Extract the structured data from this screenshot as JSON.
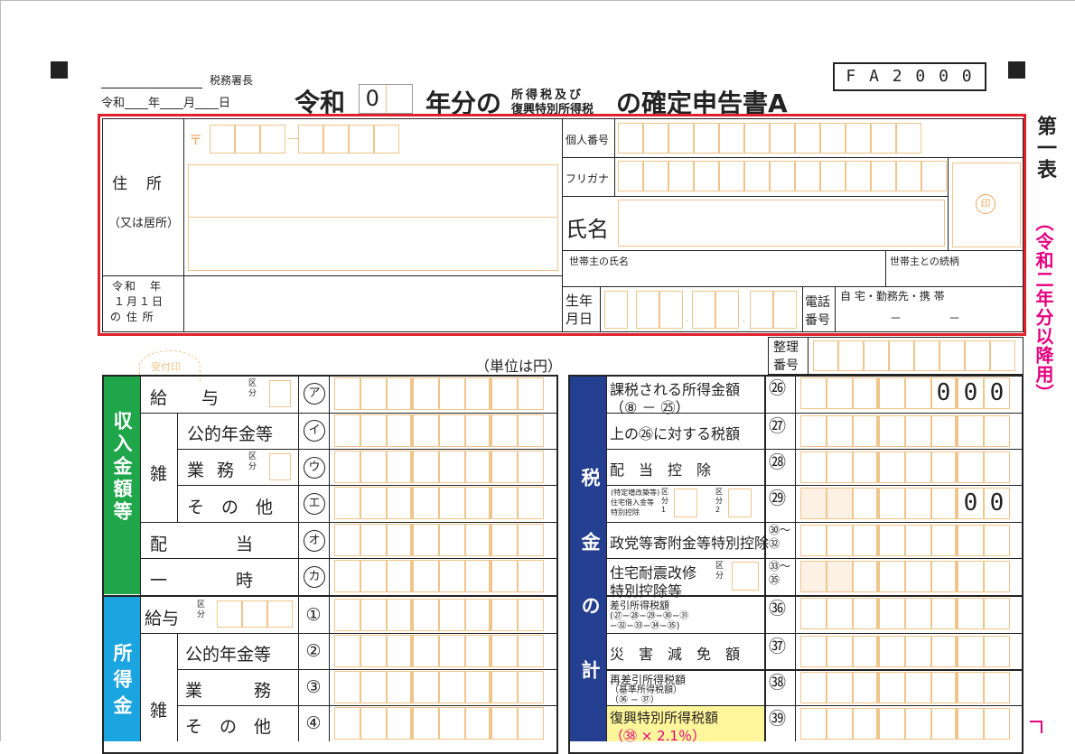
{
  "colors": {
    "red": "#e0222c",
    "orange": "#f0c48a",
    "green": "#1fa64b",
    "cyan": "#1ba5e0",
    "navy": "#243f8f",
    "magenta": "#e6007e",
    "yellow": "#fff59a"
  },
  "header": {
    "office": "税務署長",
    "date_line": "令和____年____月____日",
    "era": "令和",
    "year_box": "0",
    "year_suffix": "年分の",
    "tax_top": "所得税及び",
    "tax_bottom": "復興特別所得税",
    "title": "の確定申告書A",
    "form_code": "F A 2 0 0 0",
    "side": "第一表",
    "side_paren": "（令和二年分以降用）"
  },
  "address": {
    "postal": "〒",
    "label": "住　所",
    "label_sub": "（又は居所）",
    "jan_line1": "令和　年",
    "jan_line2": "１月１日",
    "jan_line3": "の 住 所"
  },
  "identity": {
    "my_number": "個人番号",
    "furigana": "フリガナ",
    "name": "氏名",
    "seal": "印",
    "householder": "世帯主の氏名",
    "relation": "世帯主との続柄",
    "birth1": "生年",
    "birth2": "月日",
    "phone1": "電話",
    "phone2": "番号",
    "phone_types": "自 宅・勤務先・携 帯",
    "phone_dash": "－　　　　－"
  },
  "office_use": {
    "reception": "受付印",
    "seiri1": "整理",
    "seiri2": "番号"
  },
  "unit": "（単位は円）",
  "income": {
    "section": "収入金額等",
    "rows": [
      {
        "label": "給　　与",
        "mark": "ア",
        "kubun": "区分"
      },
      {
        "label": "公的年金等",
        "mark": "イ"
      },
      {
        "label": "業 務",
        "mark": "ウ",
        "kubun": "区分"
      },
      {
        "label": "そ　の　他",
        "mark": "エ"
      },
      {
        "label": "配　　　　当",
        "mark": "オ"
      },
      {
        "label": "一　　　　時",
        "mark": "カ"
      }
    ],
    "zatsu": "雑"
  },
  "shotoku": {
    "section": "所得金",
    "rows": [
      {
        "label": "給与",
        "mark": "①",
        "kubun": "区分"
      },
      {
        "label": "公的年金等",
        "mark": "②"
      },
      {
        "label": "業　　　務",
        "mark": "③"
      },
      {
        "label": "そ　の　他",
        "mark": "④"
      }
    ],
    "zatsu": "雑"
  },
  "tax": {
    "section": "税金の計",
    "rows": [
      {
        "label1": "課税される所得金額",
        "label2": "（⑧ － ㉕）",
        "mark": "㉖",
        "fixed": "000"
      },
      {
        "label1": "上の㉖に対する税額",
        "mark": "㉗"
      },
      {
        "label1": "配　当　控　除",
        "mark": "㉘"
      },
      {
        "label1": "(特定増改築等)",
        "label2": "住宅借入金等",
        "label3": "特別控除",
        "k1": "区分1",
        "k2": "区分2",
        "mark": "㉙",
        "fixed": "00"
      },
      {
        "label1": "政党等寄附金等特別控除",
        "mark": "㉚〜㉜"
      },
      {
        "label1": "住宅耐震改修",
        "label2": "特別控除等",
        "k1": "区分",
        "mark": "㉝〜㉟"
      },
      {
        "label1": "差引所得税額",
        "label2": "(㉗−㉘−㉙−㉚−㉛",
        "label3": "−㉜−㉝−㉞−㉟)",
        "mark": "㊱"
      },
      {
        "label1": "災　害　減　免　額",
        "mark": "㊲"
      },
      {
        "label1": "再差引所得税額",
        "label2": "（基準所得税額）",
        "label3": "（㊱ − ㊲）",
        "mark": "㊳"
      },
      {
        "label1": "復興特別所得税額",
        "label2": "（㊳ × 2.1％）",
        "mark": "㊴"
      }
    ]
  }
}
